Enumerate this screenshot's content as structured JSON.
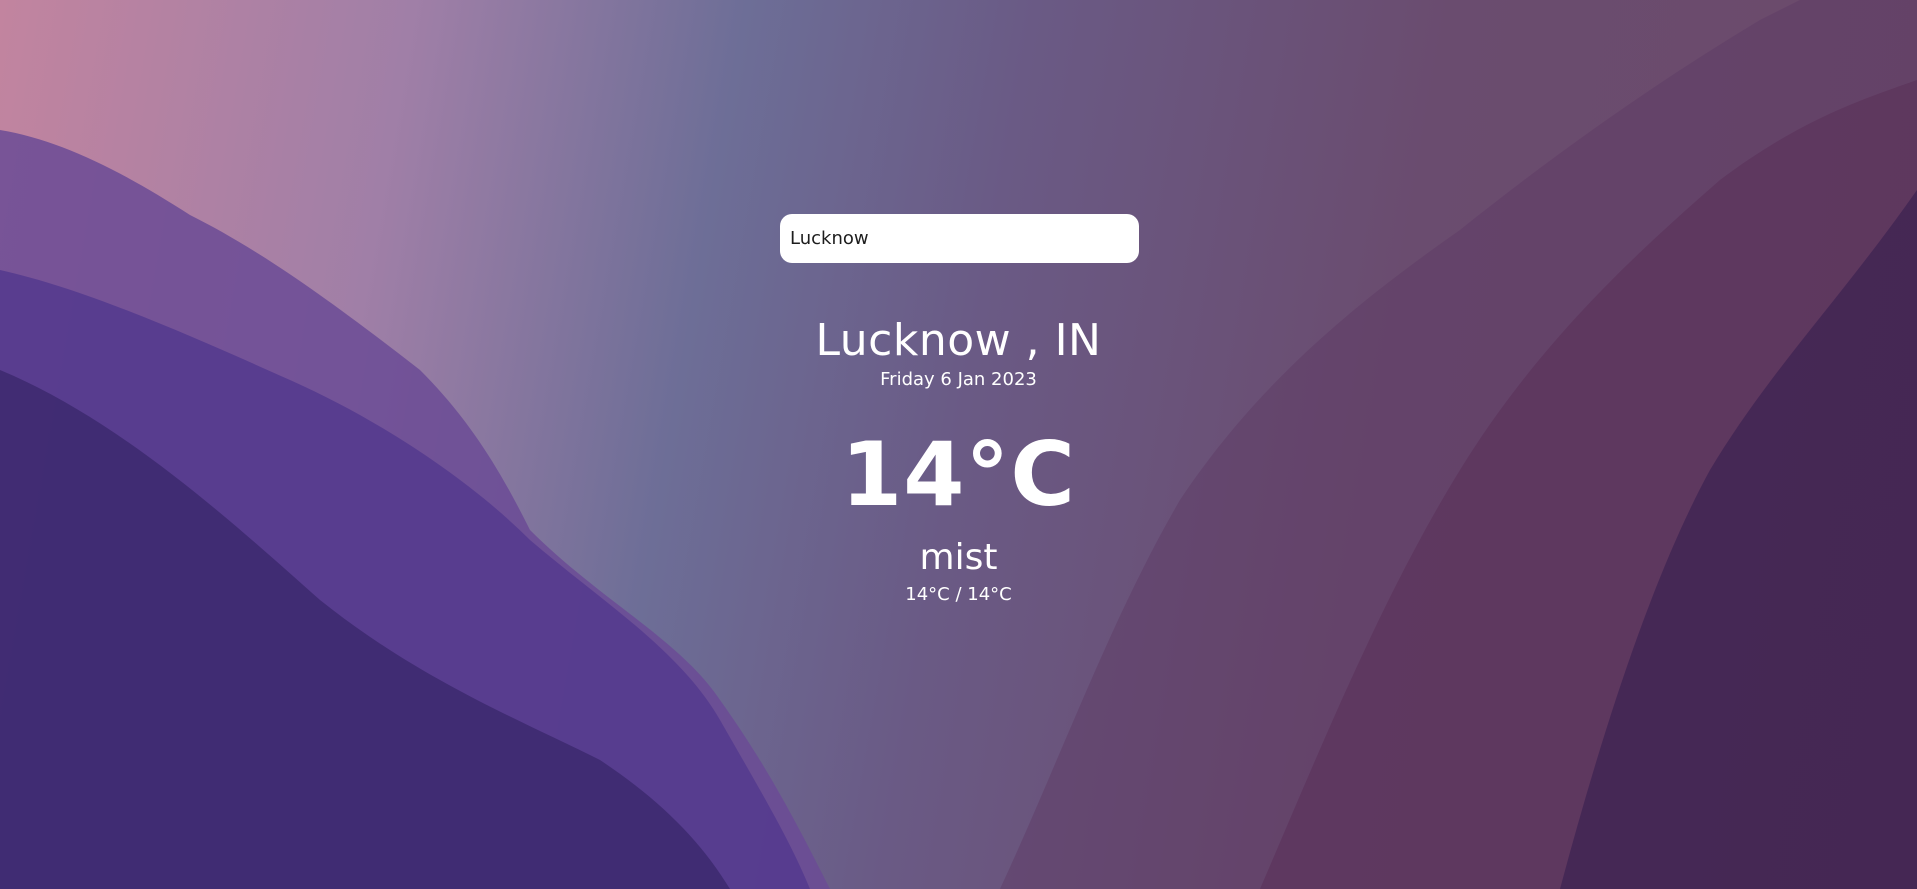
{
  "search": {
    "value": "Lucknow"
  },
  "location": {
    "city_country": "Lucknow , IN",
    "date": "Friday 6 Jan 2023"
  },
  "current": {
    "temperature": "14°C",
    "condition": "mist",
    "hi_lo": "14°C / 14°C"
  },
  "colors": {
    "text": "#ffffff",
    "search_background": "#ffffff",
    "search_text": "#1d1d1d",
    "background_left": "#c2849f",
    "background_center": "#6d6e97",
    "background_right": "#6c4a6a",
    "hills_purple": "#4a3380"
  }
}
